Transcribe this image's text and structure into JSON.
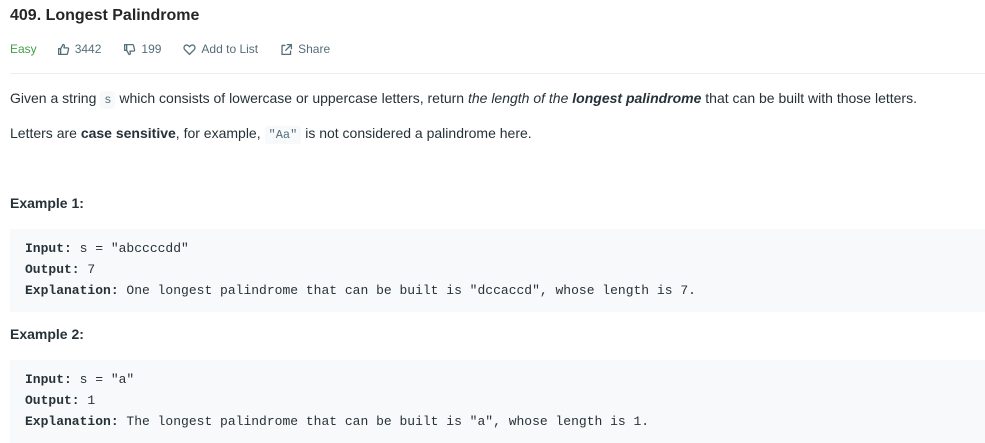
{
  "problem": {
    "title": "409. Longest Palindrome",
    "difficulty": "Easy",
    "likes": "3442",
    "dislikes": "199",
    "add_to_list_label": "Add to List",
    "share_label": "Share"
  },
  "description": {
    "p1_part1": "Given a string ",
    "p1_code": "s",
    "p1_part2": " which consists of lowercase or uppercase letters, return ",
    "p1_italic1": "the length of the ",
    "p1_bold_italic": "longest palindrome",
    "p1_part3": " that can be built with those letters.",
    "p2_part1": "Letters are ",
    "p2_bold": "case sensitive",
    "p2_part2": ", for example, ",
    "p2_code": "\"Aa\"",
    "p2_part3": " is not considered a palindrome here."
  },
  "examples": [
    {
      "heading": "Example 1:",
      "input_label": "Input:",
      "input_value": " s = \"abccccdd\"",
      "output_label": "Output:",
      "output_value": " 7",
      "explanation_label": "Explanation:",
      "explanation_value": " One longest palindrome that can be built is \"dccaccd\", whose length is 7."
    },
    {
      "heading": "Example 2:",
      "input_label": "Input:",
      "input_value": " s = \"a\"",
      "output_label": "Output:",
      "output_value": " 1",
      "explanation_label": "Explanation:",
      "explanation_value": " The longest palindrome that can be built is \"a\", whose length is 1."
    }
  ],
  "colors": {
    "easy": "#43a047",
    "meta_text": "#546e7a",
    "code_bg": "#f7f9fa"
  },
  "icons": {
    "like": "thumbs-up-icon",
    "dislike": "thumbs-down-icon",
    "add_to_list": "heart-icon",
    "share": "share-icon"
  }
}
